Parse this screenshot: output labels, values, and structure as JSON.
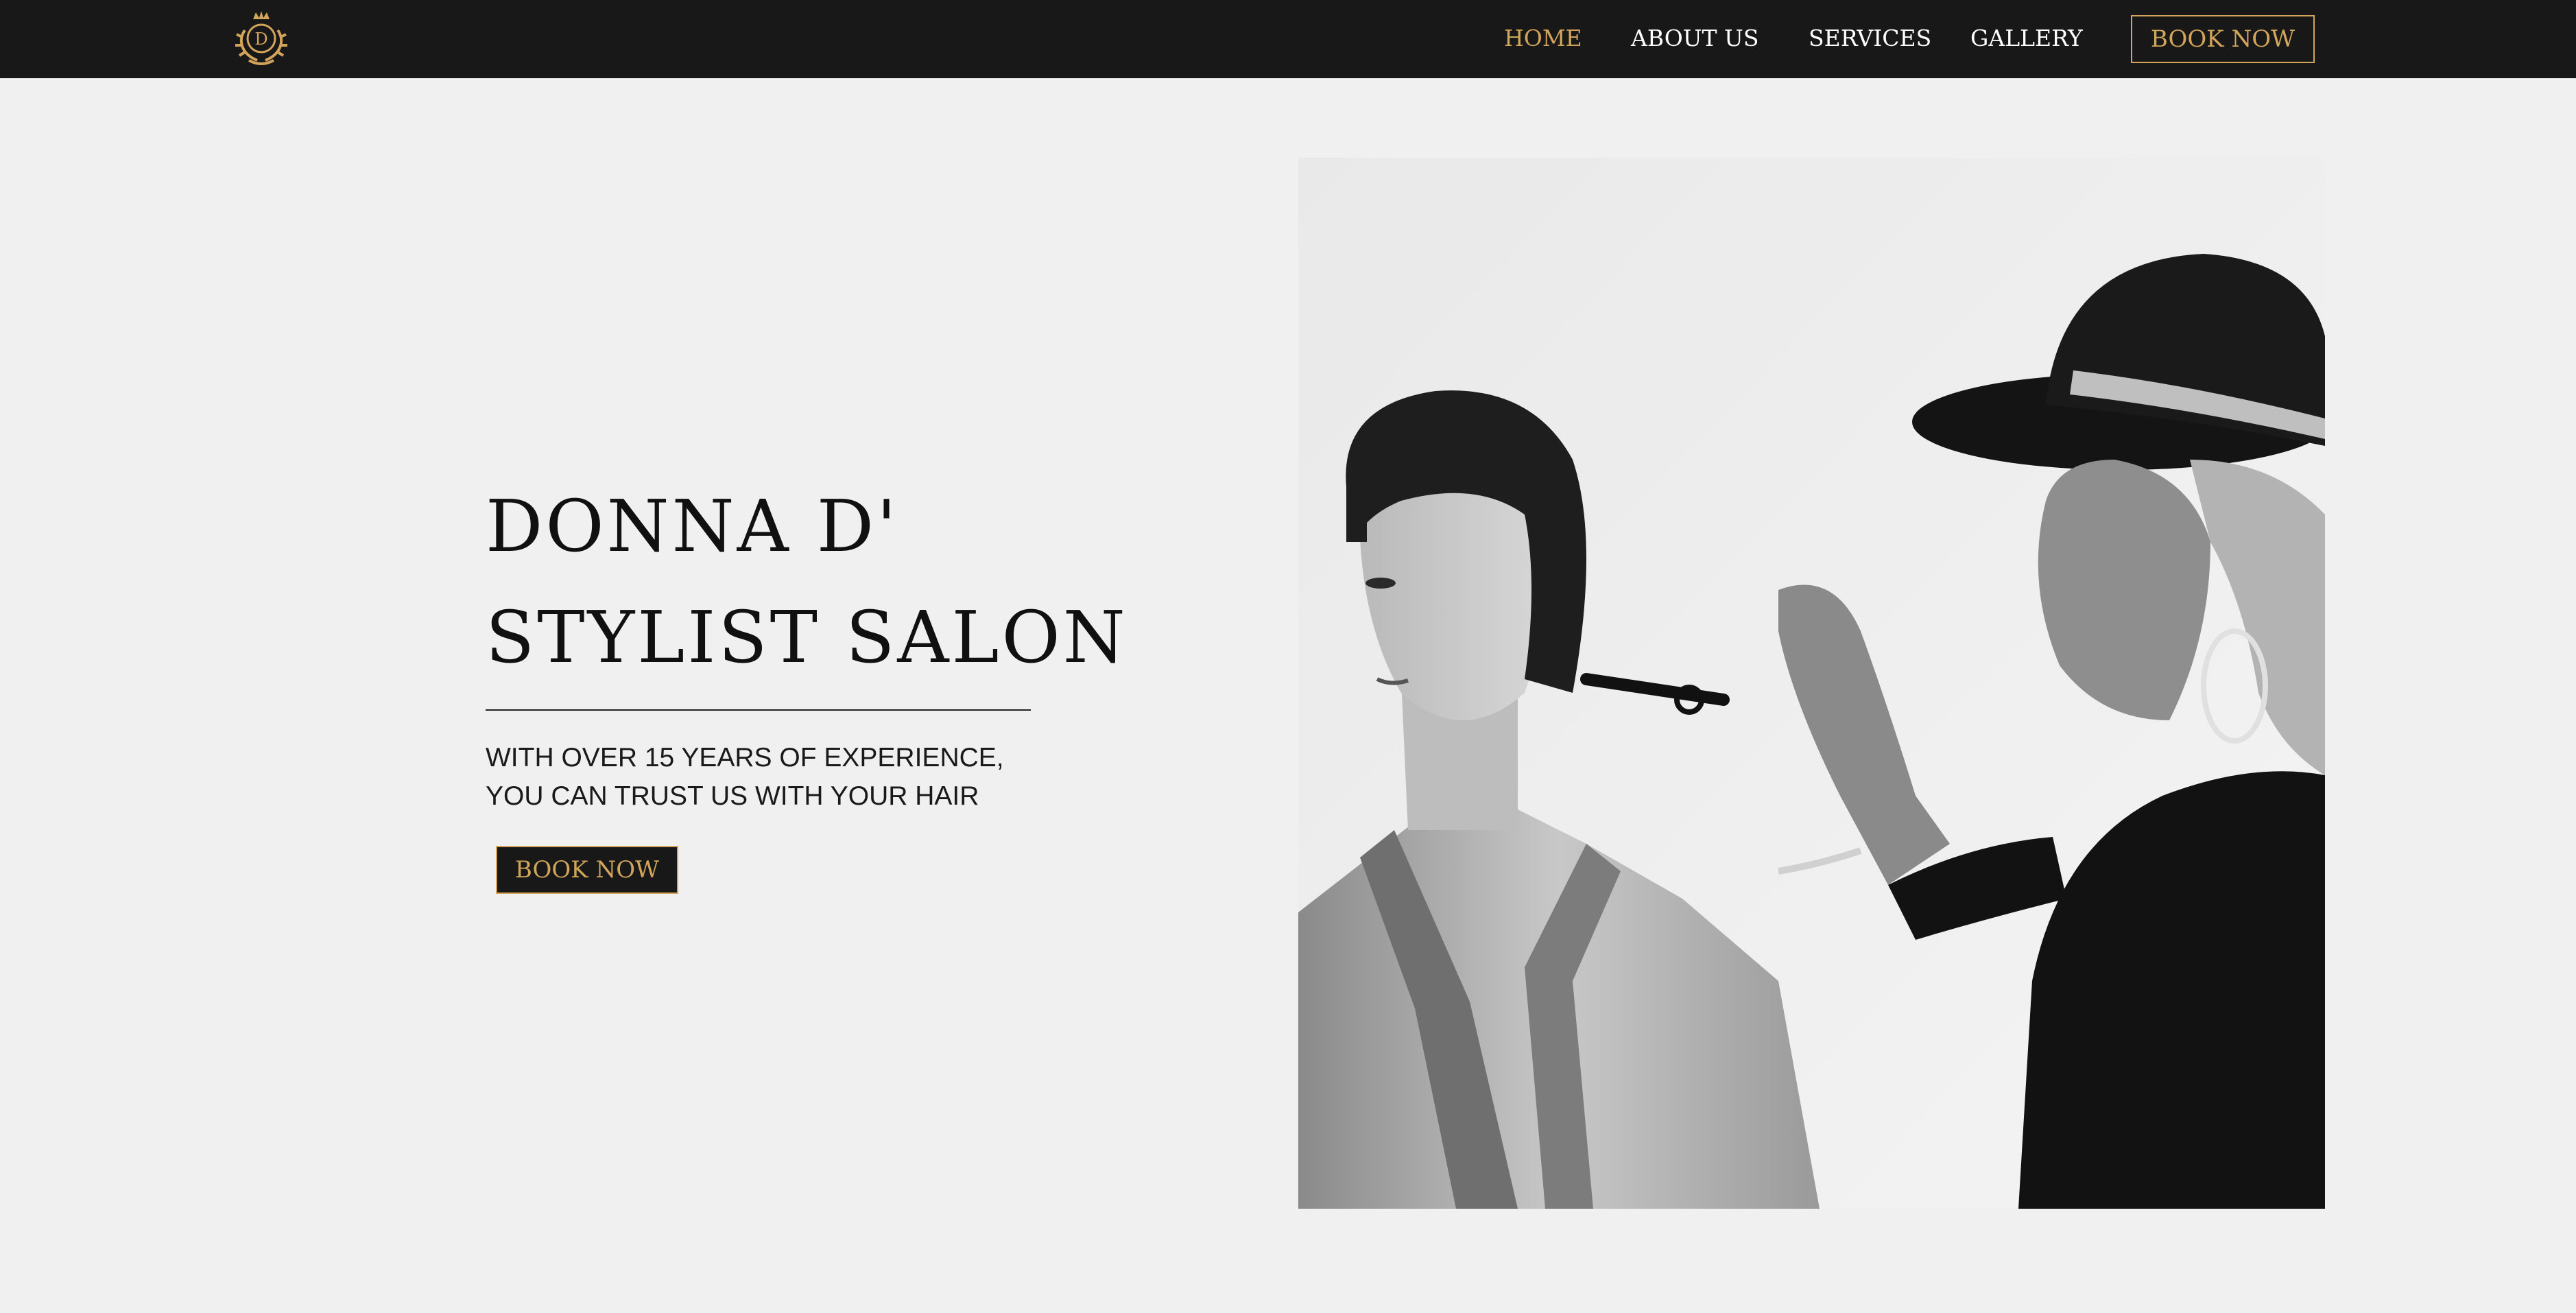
{
  "header": {
    "logo": {
      "icon": "crown-crest-icon",
      "letter": "D",
      "color": "#d2a55a"
    },
    "nav": [
      {
        "label": "HOME",
        "active": true
      },
      {
        "label": "ABOUT US",
        "active": false
      },
      {
        "label": "SERVICES",
        "active": false
      },
      {
        "label": "GALLERY",
        "active": false
      }
    ],
    "book_button": "BOOK NOW"
  },
  "hero": {
    "title_line1": "DONNA D'",
    "title_line2": "STYLIST SALON",
    "subtitle_line1": "WITH OVER 15 YEARS OF EXPERIENCE,",
    "subtitle_line2": "YOU CAN TRUST US WITH YOUR HAIR",
    "book_button": "BOOK NOW",
    "photo_icon": "stylist-cutting-hair-photo"
  },
  "colors": {
    "nav_background": "#181818",
    "page_background": "#f0f0f0",
    "accent_gold": "#d2a55a",
    "text_dark": "#101010"
  }
}
